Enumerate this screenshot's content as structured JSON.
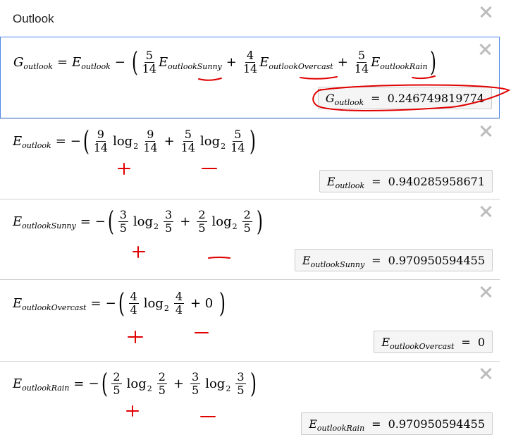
{
  "folder": {
    "title": "Outlook"
  },
  "rows": [
    {
      "lhs_base": "G",
      "lhs_sub": "outlook",
      "rhs_base": "E",
      "rhs_sub": "outlook",
      "terms": [
        {
          "num": "5",
          "den": "14",
          "base": "E",
          "sub_a": "outlook",
          "sub_b": "Sunny"
        },
        {
          "num": "4",
          "den": "14",
          "base": "E",
          "sub_a": "outlook",
          "sub_b": "Overcast"
        },
        {
          "num": "5",
          "den": "14",
          "base": "E",
          "sub_a": "outlook",
          "sub_b": "Rain"
        }
      ],
      "result": {
        "base": "G",
        "sub": "outlook",
        "eq": "=",
        "value": "0.246749819774"
      }
    },
    {
      "lhs_base": "E",
      "lhs_sub": "outlook",
      "t1": {
        "num": "9",
        "den": "14",
        "log": "log",
        "logsub": "2",
        "num2": "9",
        "den2": "14"
      },
      "t2": {
        "num": "5",
        "den": "14",
        "log": "log",
        "logsub": "2",
        "num2": "5",
        "den2": "14"
      },
      "result": {
        "base": "E",
        "sub": "outlook",
        "eq": "=",
        "value": "0.940285958671"
      }
    },
    {
      "lhs_base": "E",
      "lhs_sub": "outlookSunny",
      "t1": {
        "num": "3",
        "den": "5",
        "log": "log",
        "logsub": "2",
        "num2": "3",
        "den2": "5"
      },
      "t2": {
        "num": "2",
        "den": "5",
        "log": "log",
        "logsub": "2",
        "num2": "2",
        "den2": "5"
      },
      "result": {
        "base": "E",
        "sub": "outlookSunny",
        "eq": "=",
        "value": "0.970950594455"
      }
    },
    {
      "lhs_base": "E",
      "lhs_sub": "outlookOvercast",
      "t1": {
        "num": "4",
        "den": "4",
        "log": "log",
        "logsub": "2",
        "num2": "4",
        "den2": "4"
      },
      "plus_zero": "+ 0",
      "result": {
        "base": "E",
        "sub": "outlookOvercast",
        "eq": "=",
        "value": "0"
      }
    },
    {
      "lhs_base": "E",
      "lhs_sub": "outlookRain",
      "t1": {
        "num": "2",
        "den": "5",
        "log": "log",
        "logsub": "2",
        "num2": "2",
        "den2": "5"
      },
      "t2": {
        "num": "3",
        "den": "5",
        "log": "log",
        "logsub": "2",
        "num2": "3",
        "den2": "5"
      },
      "result": {
        "base": "E",
        "sub": "outlookRain",
        "eq": "=",
        "value": "0.970950594455"
      }
    }
  ],
  "symbols": {
    "eq": "=",
    "minus": "−",
    "plus": "+",
    "lparen": "(",
    "rparen": ")"
  },
  "annotations": {
    "plus": "+",
    "minus": "—",
    "color": "#e00000"
  }
}
